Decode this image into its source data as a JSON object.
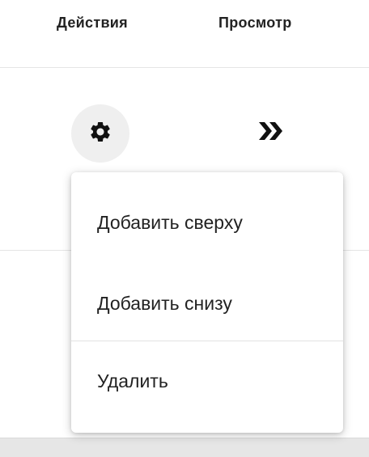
{
  "table": {
    "headers": {
      "actions": "Действия",
      "view": "Просмотр"
    },
    "row": {
      "settings_icon": "gear-icon",
      "view_icon": "double-chevron-right-icon"
    }
  },
  "menu": {
    "items": [
      {
        "label": "Добавить сверху"
      },
      {
        "label": "Добавить снизу"
      },
      {
        "label": "Удалить"
      }
    ]
  },
  "colors": {
    "icon": "#111111",
    "button_bg": "#efefef",
    "text": "#222222",
    "divider": "#e2e2e2"
  }
}
